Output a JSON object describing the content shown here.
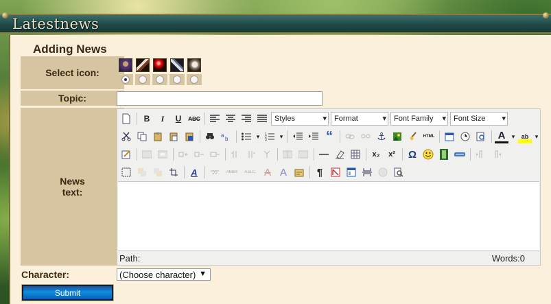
{
  "panel": {
    "title": "Latestnews"
  },
  "form": {
    "section_title": "Adding News",
    "labels": {
      "select_icon": "Select icon:",
      "topic": "Topic:",
      "news_line1": "News",
      "news_line2": "text:",
      "character": "Character:"
    },
    "icons": [
      {
        "name": "mage-portrait-icon",
        "color": "#5a3a7a",
        "checked": true
      },
      {
        "name": "axe-icon",
        "color": "#7a3a1a",
        "checked": false
      },
      {
        "name": "red-orb-icon",
        "color": "#c01010",
        "checked": false
      },
      {
        "name": "sword-icon",
        "color": "#606a80",
        "checked": false
      },
      {
        "name": "skull-icon",
        "color": "#8a7a6a",
        "checked": false
      }
    ],
    "topic_value": "",
    "character_select": {
      "selected": "(Choose character)"
    },
    "submit_label": "Submit"
  },
  "editor": {
    "dropdowns": {
      "styles": "Styles",
      "format": "Format",
      "font_family": "Font Family",
      "font_size": "Font Size"
    },
    "buttons": {
      "bold": "B",
      "italic": "I",
      "underline": "U",
      "strike": "ABC",
      "quote": "“",
      "subscript": "x₂",
      "superscript": "x²",
      "omega": "Ω",
      "pilcrow": "¶",
      "html": "HTML",
      "font_color": "A",
      "highlight": "ab",
      "abbr": "ABBR",
      "acronym": "A.B.C.",
      "cite": "“99”",
      "del": "A",
      "ins": "A",
      "underline_a": "A"
    },
    "status": {
      "path": "Path:",
      "words": "Words:0"
    }
  },
  "colors": {
    "panel_bg": "#fbf0dc",
    "label_bg": "#d7c4a0",
    "label_text": "#3b2a12",
    "header": "#1f4a47",
    "submit": "#0f8fe0"
  }
}
